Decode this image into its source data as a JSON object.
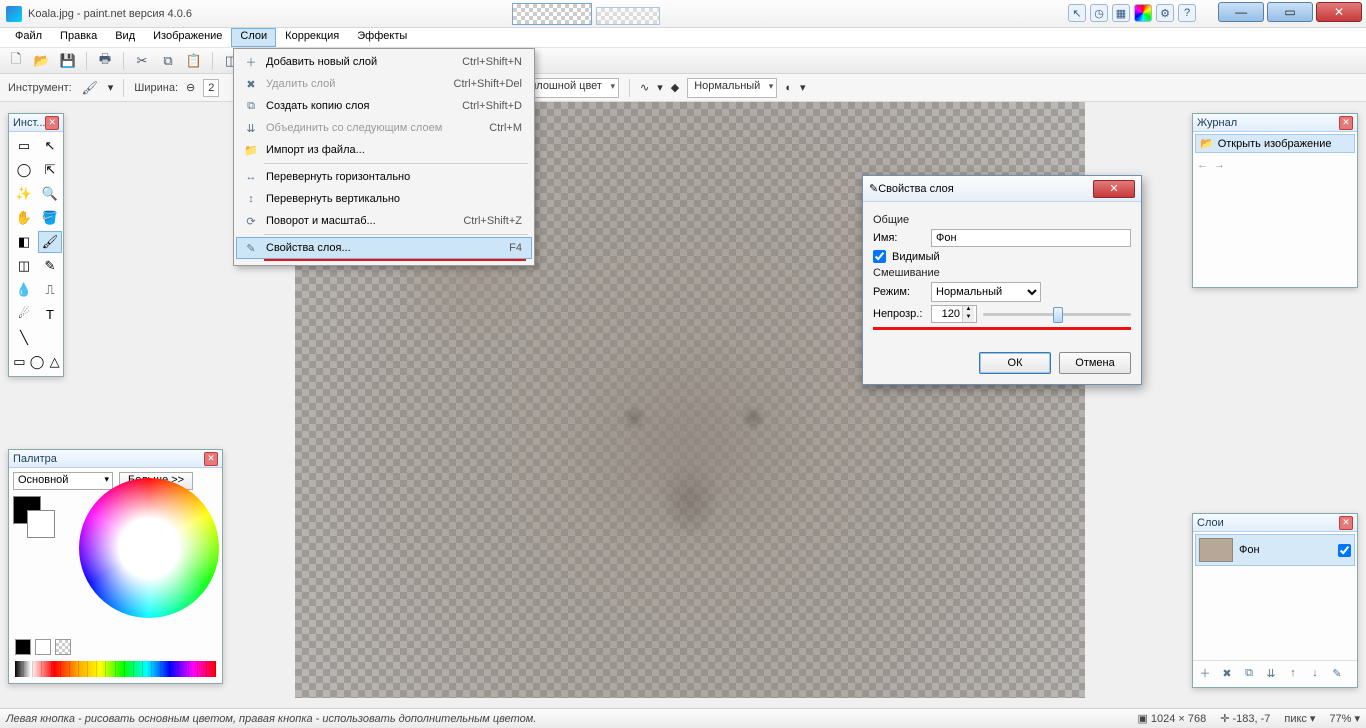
{
  "titlebar": {
    "title": "Koala.jpg - paint.net версия 4.0.6"
  },
  "winbtns": {
    "min": "—",
    "max": "▭",
    "close": "✕"
  },
  "menu": {
    "items": [
      "Файл",
      "Правка",
      "Вид",
      "Изображение",
      "Слои",
      "Коррекция",
      "Эффекты"
    ],
    "active_index": 4
  },
  "layers_menu": {
    "items": [
      {
        "icon": "＋",
        "label": "Добавить новый слой",
        "shortcut": "Ctrl+Shift+N",
        "disabled": false
      },
      {
        "icon": "✖",
        "label": "Удалить слой",
        "shortcut": "Ctrl+Shift+Del",
        "disabled": true
      },
      {
        "icon": "⧉",
        "label": "Создать копию слоя",
        "shortcut": "Ctrl+Shift+D",
        "disabled": false
      },
      {
        "icon": "⇊",
        "label": "Объединить со следующим слоем",
        "shortcut": "Ctrl+M",
        "disabled": true
      },
      {
        "icon": "📁",
        "label": "Импорт из файла...",
        "shortcut": "",
        "disabled": false
      },
      {
        "divider": true
      },
      {
        "icon": "↔",
        "label": "Перевернуть горизонтально",
        "shortcut": "",
        "disabled": false
      },
      {
        "icon": "↕",
        "label": "Перевернуть вертикально",
        "shortcut": "",
        "disabled": false
      },
      {
        "icon": "⟳",
        "label": "Поворот и масштаб...",
        "shortcut": "Ctrl+Shift+Z",
        "disabled": false
      },
      {
        "divider": true
      },
      {
        "icon": "✎",
        "label": "Свойства слоя...",
        "shortcut": "F4",
        "disabled": false,
        "highlight": true,
        "underline": true
      }
    ]
  },
  "tool_options": {
    "instrument_label": "Инструмент:",
    "width_label": "Ширина:",
    "width_value": "2",
    "fill_label": "Сплошной цвет",
    "blend_label": "Нормальный"
  },
  "tools_panel": {
    "title": "Инст..."
  },
  "palette": {
    "title": "Палитра",
    "mode": "Основной",
    "more": "Больше >>"
  },
  "history": {
    "title": "Журнал",
    "item": "Открыть изображение"
  },
  "layers_panel": {
    "title": "Слои",
    "layer_name": "Фон"
  },
  "dialog": {
    "title": "Свойства слоя",
    "section_general": "Общие",
    "name_label": "Имя:",
    "name_value": "Фон",
    "visible_label": "Видимый",
    "section_blend": "Смешивание",
    "mode_label": "Режим:",
    "mode_value": "Нормальный",
    "opacity_label": "Непрозр.:",
    "opacity_value": "120",
    "ok": "ОК",
    "cancel": "Отмена"
  },
  "status": {
    "hint": "Левая кнопка - рисовать основным цветом, правая кнопка - использовать дополнительным цветом.",
    "dims": "1024 × 768",
    "coords": "-183, -7",
    "units": "пикс",
    "zoom": "77%"
  }
}
